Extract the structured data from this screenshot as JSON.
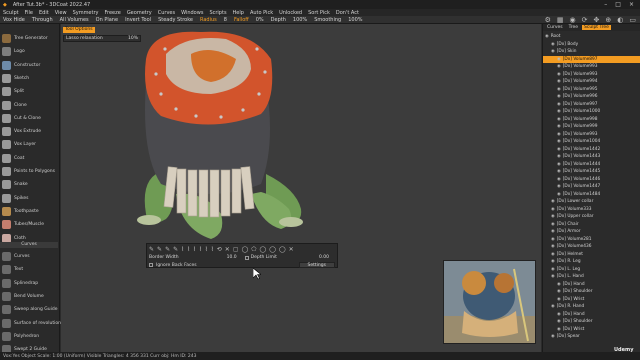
{
  "titlebar": {
    "title": "After Tut.3b* - 3DCoat 2022.47",
    "controls": [
      "–",
      "□",
      "×"
    ]
  },
  "menubar": [
    "Sculpt",
    "File",
    "Edit",
    "View",
    "Symmetry",
    "Freeze",
    "Geometry",
    "Curves",
    "Windows",
    "Scripts",
    "Help",
    "Auto Pick",
    "Unlocked",
    "Sort Pick",
    "Don't Act"
  ],
  "toolbar": {
    "items": [
      "Vox Hide",
      "Through",
      "All Volumes",
      "On Plane",
      "Invert Tool",
      "Steady Stroke",
      "Radius",
      "Falloff",
      "Depth",
      "Smoothing"
    ],
    "values": [
      "8",
      "0%",
      "0%",
      "100%",
      "100%"
    ]
  },
  "viewport": {
    "mode_tab": "Tool Options",
    "lasso": {
      "label": "Lasso relaxation",
      "value": "10%"
    }
  },
  "tools": [
    {
      "name": "Tree Generator",
      "color": "#8b6a3e"
    },
    {
      "name": "Logo",
      "color": "#7d7d7d"
    },
    {
      "name": "Constructor",
      "color": "#6d8aa8"
    },
    {
      "name": "Sketch",
      "color": "#9a9a9a"
    },
    {
      "name": "Split",
      "color": "#9a9a9a"
    },
    {
      "name": "Clone",
      "color": "#9a9a9a"
    },
    {
      "name": "Cut & Clone",
      "color": "#9a9a9a"
    },
    {
      "name": "Vox Extrude",
      "color": "#9a9a9a"
    },
    {
      "name": "Vox Layer",
      "color": "#9a9a9a"
    },
    {
      "name": "Coat",
      "color": "#9a9a9a"
    },
    {
      "name": "Points to Polygons",
      "color": "#9a9a9a"
    },
    {
      "name": "Snake",
      "color": "#9a9a9a"
    },
    {
      "name": "Spikes",
      "color": "#9a9a9a"
    },
    {
      "name": "Toothpaste",
      "color": "#b58b4e"
    },
    {
      "name": "Tubes/Muscle",
      "color": "#c47e6e"
    },
    {
      "name": "Cloth",
      "color": "#c9a7a0"
    }
  ],
  "curves_header": "Curves",
  "curve_tools": [
    {
      "name": "Curves",
      "color": "#6a6a6a"
    },
    {
      "name": "Text",
      "color": "#6a6a6a"
    },
    {
      "name": "Splinedrap",
      "color": "#6a6a6a"
    },
    {
      "name": "Bend Volume",
      "color": "#6a6a6a"
    },
    {
      "name": "Sweep along Guide",
      "color": "#6a6a6a"
    },
    {
      "name": "Surface of revolution",
      "color": "#6a6a6a"
    },
    {
      "name": "Polyhedron",
      "color": "#6a6a6a"
    },
    {
      "name": "Swept 2 Guide",
      "color": "#6a6a6a"
    },
    {
      "name": "Swept N Gener",
      "color": "#6a6a6a"
    }
  ],
  "curve_tool_panel": {
    "icons": [
      "✎",
      "✎",
      "✎",
      "✎",
      "⌇",
      "⌇",
      "⌇",
      "⌇",
      "⌇",
      "⌇",
      "⟲",
      "✕",
      "▢",
      "◯",
      "⬠",
      "◯",
      "◯",
      "◯",
      "✕"
    ],
    "border_width_label": "Border Width",
    "border_width_value": "10.0",
    "depth_limit_label": "Depth Limit",
    "depth_limit_value": "0.00",
    "ignore_back_faces": "Ignore Back Faces",
    "settings_button": "Settings"
  },
  "right_panel": {
    "tabs": [
      "Curves",
      "Tree",
      "Sculpt Tree"
    ],
    "active_tab": 2,
    "rows": [
      {
        "indent": 0,
        "text": "Root"
      },
      {
        "indent": 1,
        "text": "[Dx] Body"
      },
      {
        "indent": 1,
        "text": "[Dx] Skin"
      },
      {
        "indent": 2,
        "text": "[Dx] Volume897",
        "selected": true
      },
      {
        "indent": 2,
        "text": "[Dx] Volume993"
      },
      {
        "indent": 2,
        "text": "[Dx] Volume993"
      },
      {
        "indent": 2,
        "text": "[Dx] Volume994"
      },
      {
        "indent": 2,
        "text": "[Dx] Volume995"
      },
      {
        "indent": 2,
        "text": "[Dx] Volume996"
      },
      {
        "indent": 2,
        "text": "[Dx] Volume997"
      },
      {
        "indent": 2,
        "text": "[Dx] Volume1000"
      },
      {
        "indent": 2,
        "text": "[Dx] Volume998"
      },
      {
        "indent": 2,
        "text": "[Dx] Volume999"
      },
      {
        "indent": 2,
        "text": "[Dx] Volume993"
      },
      {
        "indent": 2,
        "text": "[Dx] Volume1004"
      },
      {
        "indent": 2,
        "text": "[Dx] Volume1442"
      },
      {
        "indent": 2,
        "text": "[Dx] Volume1443"
      },
      {
        "indent": 2,
        "text": "[Dx] Volume1444"
      },
      {
        "indent": 2,
        "text": "[Dx] Volume1445"
      },
      {
        "indent": 2,
        "text": "[Dx] Volume1446"
      },
      {
        "indent": 2,
        "text": "[Dx] Volume1447"
      },
      {
        "indent": 2,
        "text": "[Dx] Volume1484"
      },
      {
        "indent": 1,
        "text": "[Dx] Lower collar"
      },
      {
        "indent": 1,
        "text": "[Dx] Volume333"
      },
      {
        "indent": 1,
        "text": "[Dx] Upper collar"
      },
      {
        "indent": 1,
        "text": "[Dx] Chair"
      },
      {
        "indent": 1,
        "text": "[Dx] Armor"
      },
      {
        "indent": 1,
        "text": "[Dx] Volume281"
      },
      {
        "indent": 1,
        "text": "[Dx] Volume436"
      },
      {
        "indent": 1,
        "text": "[Dx] Helmet"
      },
      {
        "indent": 1,
        "text": "[Dx] R. Leg"
      },
      {
        "indent": 1,
        "text": "[Dx] L. Leg"
      },
      {
        "indent": 1,
        "text": "[Dx] L. Hand"
      },
      {
        "indent": 2,
        "text": "[Dx] Hand"
      },
      {
        "indent": 2,
        "text": "[Dx] Shoulder"
      },
      {
        "indent": 2,
        "text": "[Dx] Wrist"
      },
      {
        "indent": 1,
        "text": "[Dx] R. Hand"
      },
      {
        "indent": 2,
        "text": "[Dx] Hand"
      },
      {
        "indent": 2,
        "text": "[Dx] Shoulder"
      },
      {
        "indent": 2,
        "text": "[Dx] Wrist"
      },
      {
        "indent": 1,
        "text": "[Dx] Spear"
      }
    ]
  },
  "statusbar": "Vox:Yes  Object Scale: 1:00 (Uniform)  Visible Triangles: 4 356 331  Curr obj: Hm  ID: 243",
  "watermark": "Udemy"
}
